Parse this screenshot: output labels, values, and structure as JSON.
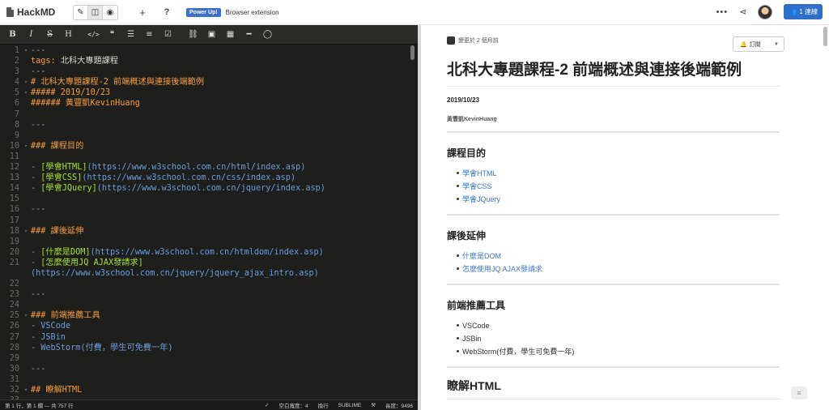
{
  "nav": {
    "brand": "HackMD",
    "powerup": "Power Up!",
    "extension": "Browser extension",
    "online": "1 連線"
  },
  "editor_lines": [
    {
      "n": "1",
      "fold": "v",
      "cls": "c-hr",
      "t": "---"
    },
    {
      "n": "2",
      "fold": "",
      "cls": "c-tag",
      "t": "tags: ",
      "t2": "北科大專題課程",
      "cls2": "c-plain"
    },
    {
      "n": "3",
      "fold": "",
      "cls": "c-hr",
      "t": "---"
    },
    {
      "n": "4",
      "fold": "v",
      "cls": "c-hdr",
      "t": "# 北科大專題課程-2 前端概述與連接後端範例"
    },
    {
      "n": "5",
      "fold": "v",
      "cls": "c-hdr",
      "t": "##### 2019/10/23"
    },
    {
      "n": "6",
      "fold": "",
      "cls": "c-hdr",
      "t": "###### 黃豐凱KevinHuang"
    },
    {
      "n": "7",
      "fold": "",
      "cls": "c-plain",
      "t": ""
    },
    {
      "n": "8",
      "fold": "",
      "cls": "c-hr",
      "t": "---"
    },
    {
      "n": "9",
      "fold": "",
      "cls": "c-plain",
      "t": ""
    },
    {
      "n": "10",
      "fold": "v",
      "cls": "c-hdr",
      "t": "### 課程目的"
    },
    {
      "n": "11",
      "fold": "",
      "cls": "c-plain",
      "t": ""
    },
    {
      "n": "12",
      "fold": "",
      "cls": "c-bullet",
      "t": "- ",
      "t2": "[學會HTML]",
      "cls2": "c-link",
      "t3": "(https://www.w3school.com.cn/html/index.asp)",
      "cls3": "c-url"
    },
    {
      "n": "13",
      "fold": "",
      "cls": "c-bullet",
      "t": "- ",
      "t2": "[學會CSS]",
      "cls2": "c-link",
      "t3": "(https://www.w3school.com.cn/css/index.asp)",
      "cls3": "c-url"
    },
    {
      "n": "14",
      "fold": "",
      "cls": "c-bullet",
      "t": "- ",
      "t2": "[學會JQuery]",
      "cls2": "c-link",
      "t3": "(https://www.w3school.com.cn/jquery/index.asp)",
      "cls3": "c-url"
    },
    {
      "n": "15",
      "fold": "",
      "cls": "c-plain",
      "t": ""
    },
    {
      "n": "16",
      "fold": "",
      "cls": "c-hr",
      "t": "---"
    },
    {
      "n": "17",
      "fold": "",
      "cls": "c-plain",
      "t": ""
    },
    {
      "n": "18",
      "fold": "v",
      "cls": "c-hdr",
      "t": "### 課後延伸"
    },
    {
      "n": "19",
      "fold": "",
      "cls": "c-plain",
      "t": ""
    },
    {
      "n": "20",
      "fold": "",
      "cls": "c-bullet",
      "t": "- ",
      "t2": "[什麼是DOM]",
      "cls2": "c-link",
      "t3": "(https://www.w3school.com.cn/htmldom/index.asp)",
      "cls3": "c-url"
    },
    {
      "n": "21",
      "fold": "",
      "cls": "c-bullet",
      "t": "- ",
      "t2": "[怎麼使用JQ AJAX發請求]",
      "cls2": "c-link"
    },
    {
      "n": "",
      "fold": "",
      "cls": "c-url",
      "t": "(https://www.w3school.com.cn/jquery/jquery_ajax_intro.asp)"
    },
    {
      "n": "22",
      "fold": "",
      "cls": "c-plain",
      "t": ""
    },
    {
      "n": "23",
      "fold": "",
      "cls": "c-hr",
      "t": "---"
    },
    {
      "n": "24",
      "fold": "",
      "cls": "c-plain",
      "t": ""
    },
    {
      "n": "25",
      "fold": "v",
      "cls": "c-hdr",
      "t": "### 前端推薦工具"
    },
    {
      "n": "26",
      "fold": "",
      "cls": "c-bullet",
      "t": "- VSCode"
    },
    {
      "n": "27",
      "fold": "",
      "cls": "c-bullet",
      "t": "- JSBin"
    },
    {
      "n": "28",
      "fold": "",
      "cls": "c-bullet",
      "t": "- WebStorm(付費，學生可免費一年)"
    },
    {
      "n": "29",
      "fold": "",
      "cls": "c-plain",
      "t": ""
    },
    {
      "n": "30",
      "fold": "",
      "cls": "c-hr",
      "t": "---"
    },
    {
      "n": "31",
      "fold": "",
      "cls": "c-plain",
      "t": ""
    },
    {
      "n": "32",
      "fold": "v",
      "cls": "c-hdr",
      "t": "## 瞭解HTML"
    },
    {
      "n": "33",
      "fold": "",
      "cls": "c-plain",
      "t": ""
    }
  ],
  "status": {
    "cursor": "第 1 行，第 1 欄 — 共 757 行",
    "indent": "空白寬度：4",
    "wrap": "換行",
    "keymap": "SUBLIME",
    "length": "長度：9496"
  },
  "preview": {
    "changed": "變更於 2 個月前",
    "subscribe": "訂閱",
    "title": "北科大專題課程-2 前端概述與連接後端範例",
    "date": "2019/10/23",
    "author": "黃豐凱KevinHuang",
    "s1": {
      "title": "課程目的",
      "items": [
        "學會HTML",
        "學會CSS",
        "學會JQuery"
      ]
    },
    "s2": {
      "title": "課後延伸",
      "items": [
        "什麼是DOM",
        "怎麼使用JQ AJAX發請求"
      ]
    },
    "s3": {
      "title": "前端推薦工具",
      "items": [
        "VSCode",
        "JSBin",
        "WebStorm(付費，學生可免費一年)"
      ]
    },
    "s4": {
      "title": "瞭解HTML"
    }
  }
}
